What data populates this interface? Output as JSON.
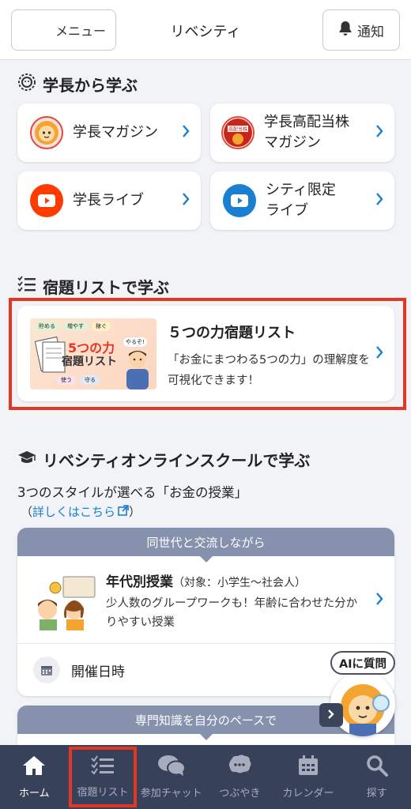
{
  "header": {
    "menu_label": "メニュー",
    "title": "リベシティ",
    "notify_label": "通知"
  },
  "sections": {
    "president": {
      "title": "学長から学ぶ",
      "cards": [
        {
          "label_line1": "学長マガジン",
          "label_line2": ""
        },
        {
          "label_line1": "学長高配当株",
          "label_line2": "マガジン"
        },
        {
          "label_line1": "学長ライブ",
          "label_line2": ""
        },
        {
          "label_line1": "シティ限定",
          "label_line2": "ライブ"
        }
      ]
    },
    "homework": {
      "title": "宿題リストで学ぶ",
      "card_title": "５つの力宿題リスト",
      "card_desc": "「お金にまつわる5つの力」の理解度を可視化できます！",
      "thumb": {
        "tags_top": [
          "貯める",
          "増やす",
          "稼ぐ"
        ],
        "big1": "5つの力",
        "big2": "宿題リスト",
        "speech": "やるぞ!",
        "tags_bottom": [
          "使う",
          "守る"
        ]
      }
    },
    "online_school": {
      "title": "リベシティオンラインスクールで学ぶ",
      "subtitle": "3つのスタイルが選べる「お金の授業」",
      "link_open": "（",
      "link_text": "詳しくはこちら",
      "link_close": "）",
      "class1": {
        "tab": "同世代と交流しながら",
        "title": "年代別授業",
        "target": "（対象：小学生〜社会人）",
        "desc": "少人数のグループワークも！年齢に合わせた分かりやすい授業",
        "date_label": "開催日時"
      },
      "class2": {
        "tab": "専門知識を自分のペースで"
      }
    }
  },
  "ai_button": {
    "label": "AIに質問"
  },
  "bottom_nav": [
    {
      "label": "ホーム",
      "icon": "home-icon",
      "active": true
    },
    {
      "label": "宿題リスト",
      "icon": "checklist-icon",
      "active": false
    },
    {
      "label": "参加チャット",
      "icon": "chat-bubbles-icon",
      "active": false
    },
    {
      "label": "つぶやき",
      "icon": "tweet-bubble-icon",
      "active": false
    },
    {
      "label": "カレンダー",
      "icon": "calendar-icon",
      "active": false
    },
    {
      "label": "探す",
      "icon": "search-icon",
      "active": false
    }
  ],
  "colors": {
    "accent_blue": "#1a7fd0",
    "youtube_red": "#ff3b00",
    "highlight_red": "#e53624",
    "nav_bg": "#37415a",
    "tab_bg": "#8591ad"
  }
}
